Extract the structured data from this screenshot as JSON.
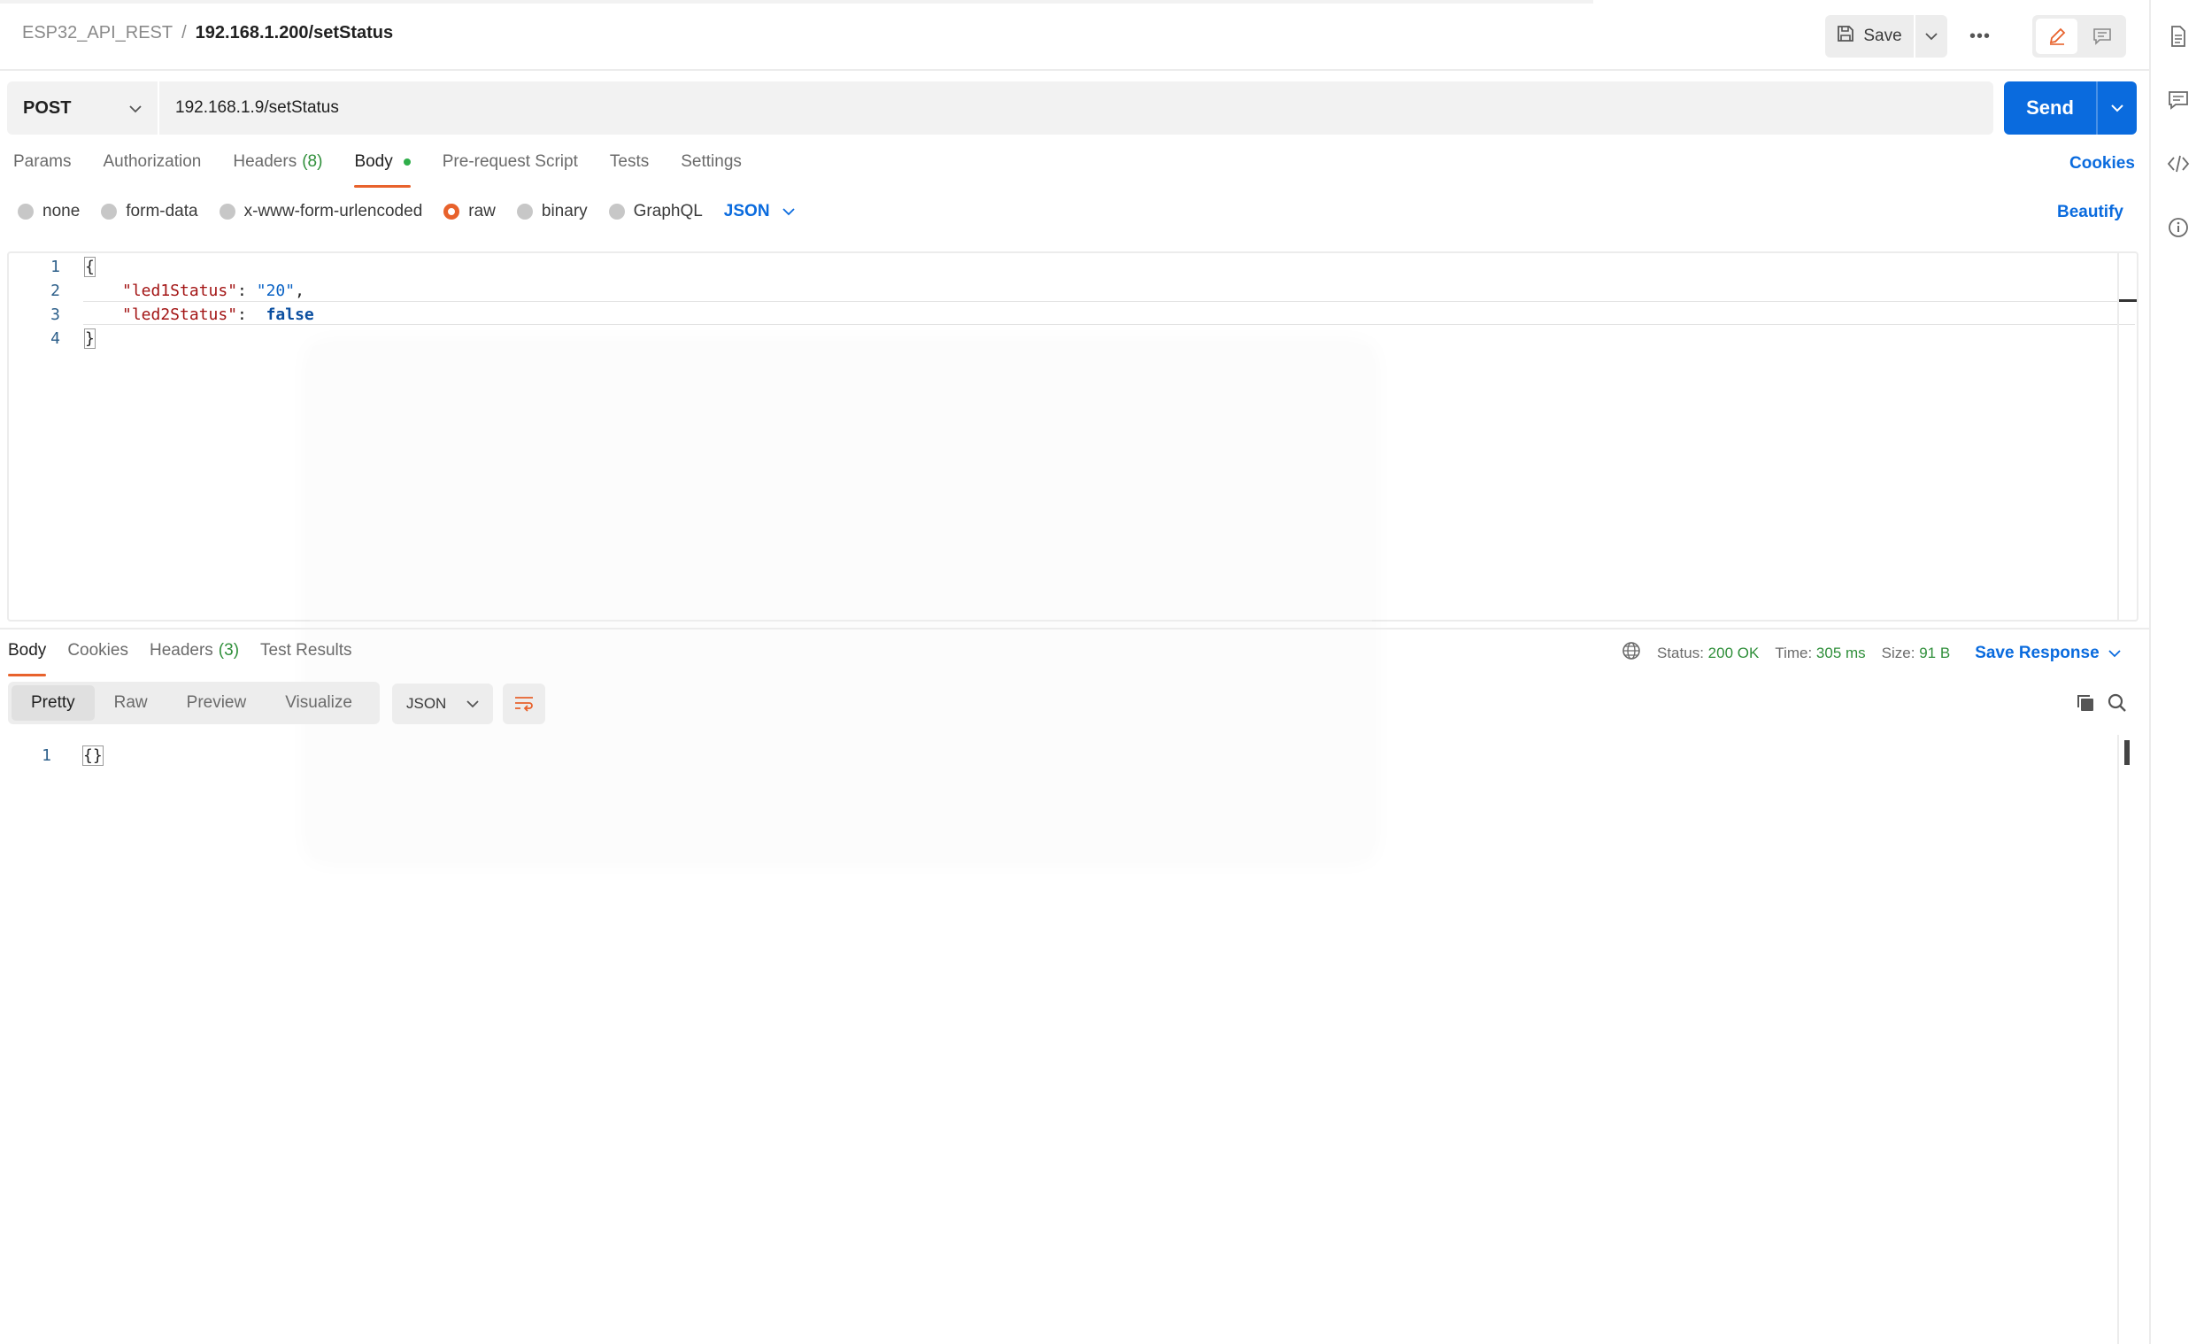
{
  "header": {
    "collection": "ESP32_API_REST",
    "separator": "/",
    "request_name": "192.168.1.200/setStatus",
    "save_label": "Save",
    "more_label": "•••"
  },
  "request": {
    "method": "POST",
    "url": "192.168.1.9/setStatus",
    "send_label": "Send"
  },
  "request_tabs": [
    {
      "label": "Params"
    },
    {
      "label": "Authorization"
    },
    {
      "label": "Headers",
      "count": "(8)"
    },
    {
      "label": "Body",
      "active": true
    },
    {
      "label": "Pre-request Script"
    },
    {
      "label": "Tests"
    },
    {
      "label": "Settings"
    }
  ],
  "cookies_label": "Cookies",
  "body_types": [
    {
      "label": "none"
    },
    {
      "label": "form-data"
    },
    {
      "label": "x-www-form-urlencoded"
    },
    {
      "label": "raw",
      "selected": true
    },
    {
      "label": "binary"
    },
    {
      "label": "GraphQL"
    }
  ],
  "body_language": "JSON",
  "beautify_label": "Beautify",
  "editor": {
    "lines": [
      {
        "n": "1",
        "text": "{"
      },
      {
        "n": "2",
        "key": "\"led1Status\"",
        "value": "\"20\""
      },
      {
        "n": "3",
        "key": "\"led2Status\"",
        "value": "false"
      },
      {
        "n": "4",
        "text": "}"
      }
    ]
  },
  "response": {
    "tabs": [
      {
        "label": "Body",
        "active": true
      },
      {
        "label": "Cookies"
      },
      {
        "label": "Headers",
        "count": "(3)"
      },
      {
        "label": "Test Results"
      }
    ],
    "status_label": "Status:",
    "status_value": "200 OK",
    "time_label": "Time:",
    "time_value": "305 ms",
    "size_label": "Size:",
    "size_value": "91 B",
    "save_response_label": "Save Response",
    "view_modes": [
      "Pretty",
      "Raw",
      "Preview",
      "Visualize"
    ],
    "format": "JSON",
    "body_lines": [
      {
        "n": "1",
        "text": "{}"
      }
    ]
  },
  "colors": {
    "accent_blue": "#0a6bde",
    "accent_orange": "#e8622c",
    "success_green": "#2f8f3a"
  },
  "icons": [
    "document-icon",
    "comment-icon",
    "code-icon",
    "info-icon",
    "save-icon",
    "chevron-down-icon",
    "more-icon",
    "pencil-icon",
    "globe-icon",
    "wrap-lines-icon",
    "copy-icon",
    "search-icon"
  ]
}
